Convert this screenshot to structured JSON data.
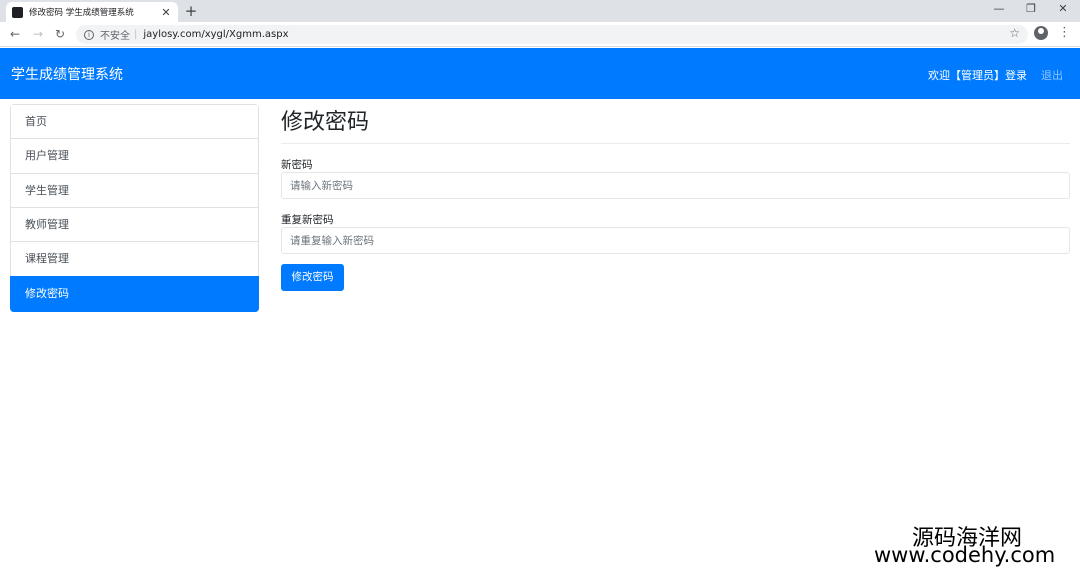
{
  "browser": {
    "tab_title": "修改密码 学生成绩管理系统",
    "tab_close": "✕",
    "new_tab": "+",
    "insecure_label": "不安全",
    "url": "jaylosy.com/xygl/Xgmm.aspx"
  },
  "navbar": {
    "brand": "学生成绩管理系统",
    "welcome": "欢迎【管理员】登录",
    "logout": "退出"
  },
  "sidebar": {
    "items": [
      {
        "label": "首页"
      },
      {
        "label": "用户管理"
      },
      {
        "label": "学生管理"
      },
      {
        "label": "教师管理"
      },
      {
        "label": "课程管理"
      },
      {
        "label": "修改密码",
        "active": true
      }
    ]
  },
  "form": {
    "title": "修改密码",
    "new_password_label": "新密码",
    "new_password_placeholder": "请输入新密码",
    "repeat_password_label": "重复新密码",
    "repeat_password_placeholder": "请重复输入新密码",
    "submit_label": "修改密码"
  },
  "watermark": {
    "line1": "源码海洋网",
    "line2": "www.codehy.com"
  },
  "colors": {
    "primary": "#007bff",
    "tabbar": "#dee1e6"
  }
}
